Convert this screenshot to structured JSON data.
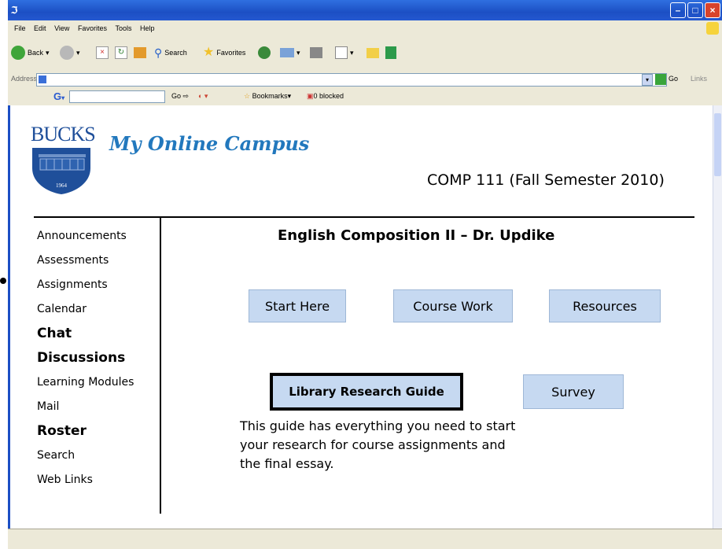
{
  "browser": {
    "menu": [
      "File",
      "Edit",
      "View",
      "Favorites",
      "Tools",
      "Help"
    ],
    "toolbar": {
      "back": "Back",
      "search": "Search",
      "favorites": "Favorites"
    },
    "address_label": "Address",
    "go_label": "Go",
    "links_label": "Links",
    "google_bar": {
      "go_label": "Go",
      "bookmarks": "Bookmarks",
      "blocked": "0 blocked"
    }
  },
  "site": {
    "logo_text": "BUCKS",
    "logo_year": "1964",
    "title": "My Online Campus",
    "course": "COMP 111 (Fall Semester 2010)"
  },
  "nav": [
    {
      "label": "Announcements",
      "size": "sm"
    },
    {
      "label": "Assessments",
      "size": "sm"
    },
    {
      "label": "Assignments",
      "size": "sm"
    },
    {
      "label": "Calendar",
      "size": "sm"
    },
    {
      "label": "Chat",
      "size": "lg"
    },
    {
      "label": "Discussions",
      "size": "lg"
    },
    {
      "label": "Learning Modules",
      "size": "sm"
    },
    {
      "label": "Mail",
      "size": "sm"
    },
    {
      "label": "Roster",
      "size": "lg"
    },
    {
      "label": "Search",
      "size": "sm"
    },
    {
      "label": "Web Links",
      "size": "sm"
    }
  ],
  "main": {
    "heading": "English Composition II – Dr. Updike",
    "buttons": {
      "start_here": "Start Here",
      "course_work": "Course Work",
      "resources": "Resources",
      "library_guide": "Library Research Guide",
      "survey": "Survey"
    },
    "description": "This guide has everything you need to start your research  for course assignments and the final essay."
  },
  "colors": {
    "title_blue": "#2278bd",
    "button_fill": "#c6d9f1",
    "xp_titlebar": "#1c4fc4"
  }
}
